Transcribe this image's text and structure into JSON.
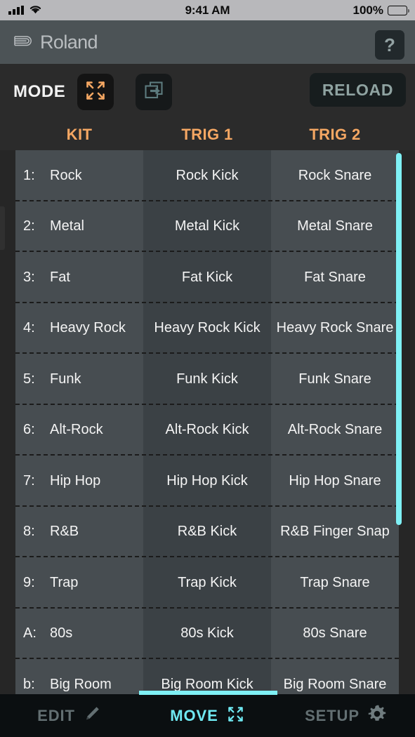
{
  "status_bar": {
    "signal_icon": "cellular-signal-icon",
    "wifi_icon": "wifi-icon",
    "time": "9:41 AM",
    "battery_percent": "100%",
    "battery_icon": "battery-full-icon"
  },
  "brand_bar": {
    "logo_mark": "roland-logo-mark",
    "logo_text": "Roland",
    "help_label": "?"
  },
  "mode_bar": {
    "label": "MODE",
    "buttons": [
      {
        "name": "mode-move-button",
        "icon": "expand-arrows-icon",
        "state": "selected",
        "color": "#f5a763"
      },
      {
        "name": "mode-copy-button",
        "icon": "copy-duplicate-icon",
        "state": "unselected",
        "color": "#5d7b7e"
      }
    ],
    "reload_label": "RELOAD"
  },
  "columns": [
    {
      "key": "kit",
      "label": "KIT"
    },
    {
      "key": "trig1",
      "label": "TRIG 1"
    },
    {
      "key": "trig2",
      "label": "TRIG 2"
    }
  ],
  "rows": [
    {
      "index": "1:",
      "kit": "Rock",
      "trig1": "Rock Kick",
      "trig2": "Rock Snare"
    },
    {
      "index": "2:",
      "kit": "Metal",
      "trig1": "Metal Kick",
      "trig2": "Metal Snare"
    },
    {
      "index": "3:",
      "kit": "Fat",
      "trig1": "Fat Kick",
      "trig2": "Fat Snare"
    },
    {
      "index": "4:",
      "kit": "Heavy Rock",
      "trig1": "Heavy Rock Kick",
      "trig2": "Heavy Rock Snare"
    },
    {
      "index": "5:",
      "kit": "Funk",
      "trig1": "Funk Kick",
      "trig2": "Funk Snare"
    },
    {
      "index": "6:",
      "kit": "Alt-Rock",
      "trig1": "Alt-Rock Kick",
      "trig2": "Alt-Rock Snare"
    },
    {
      "index": "7:",
      "kit": "Hip Hop",
      "trig1": "Hip Hop Kick",
      "trig2": "Hip Hop Snare"
    },
    {
      "index": "8:",
      "kit": "R&B",
      "trig1": "R&B Kick",
      "trig2": "R&B Finger Snap"
    },
    {
      "index": "9:",
      "kit": "Trap",
      "trig1": "Trap Kick",
      "trig2": "Trap Snare"
    },
    {
      "index": "A:",
      "kit": "80s",
      "trig1": "80s Kick",
      "trig2": "80s Snare"
    },
    {
      "index": "b:",
      "kit": "Big Room",
      "trig1": "Big Room Kick",
      "trig2": "Big Room Snare"
    }
  ],
  "scrollbar": {
    "name": "vertical-scrollbar",
    "color": "#7ff0f5"
  },
  "bottom_nav": {
    "items": [
      {
        "name": "nav-edit",
        "label": "EDIT",
        "icon": "pencil-icon",
        "active": false
      },
      {
        "name": "nav-move",
        "label": "MOVE",
        "icon": "expand-arrows-icon",
        "active": true
      },
      {
        "name": "nav-setup",
        "label": "SETUP",
        "icon": "gear-icon",
        "active": false
      }
    ]
  },
  "theme": {
    "accent_orange": "#f5a763",
    "accent_cyan": "#7ff0f5",
    "bg_dark": "#262626",
    "row_light": "#474d51",
    "row_dark": "#3b4145"
  }
}
